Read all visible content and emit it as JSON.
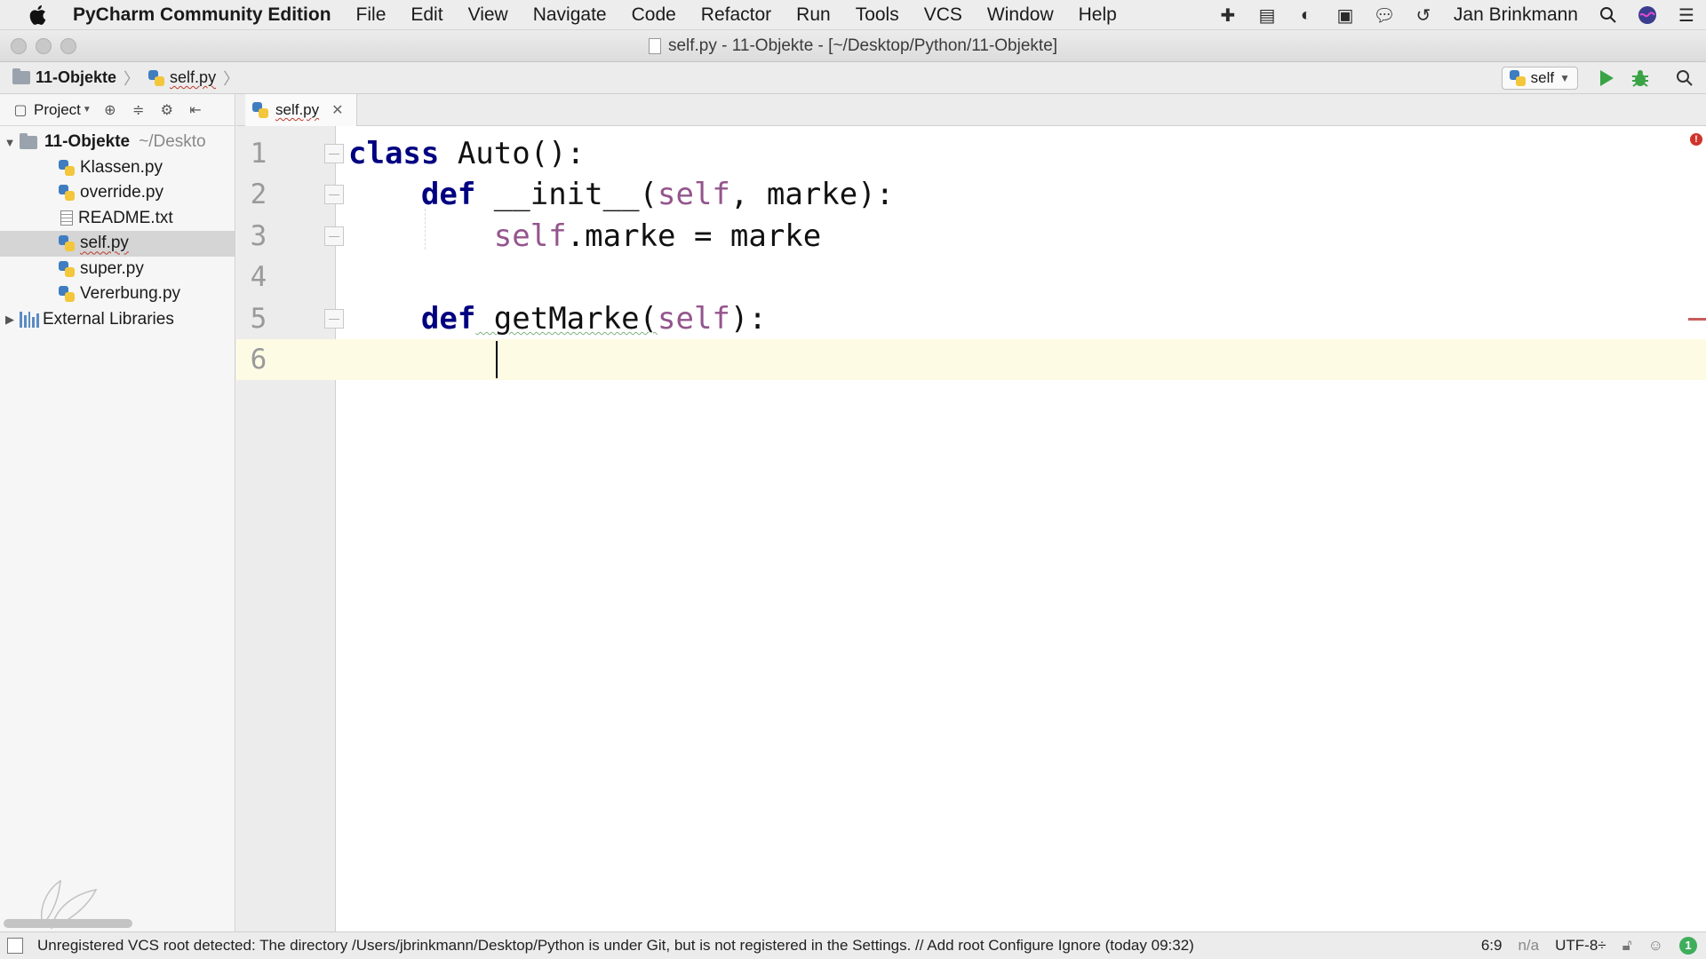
{
  "menubar": {
    "app_name": "PyCharm Community Edition",
    "items": [
      "File",
      "Edit",
      "View",
      "Navigate",
      "Code",
      "Refactor",
      "Run",
      "Tools",
      "VCS",
      "Window",
      "Help"
    ],
    "user": "Jan Brinkmann"
  },
  "window": {
    "title": "self.py - 11-Objekte - [~/Desktop/Python/11-Objekte]"
  },
  "navbar": {
    "project_crumb": "11-Objekte",
    "file_crumb": "self.py",
    "run_config": "self"
  },
  "project_panel": {
    "view_label": "Project",
    "root_name": "11-Objekte",
    "root_path": "~/Deskto",
    "files": [
      {
        "name": "Klassen.py",
        "type": "python"
      },
      {
        "name": "override.py",
        "type": "python"
      },
      {
        "name": "README.txt",
        "type": "text"
      },
      {
        "name": "self.py",
        "type": "python"
      },
      {
        "name": "super.py",
        "type": "python"
      },
      {
        "name": "Vererbung.py",
        "type": "python"
      }
    ],
    "external_libraries": "External Libraries"
  },
  "editor": {
    "tab_label": "self.py",
    "line_numbers": [
      "1",
      "2",
      "3",
      "4",
      "5",
      "6"
    ],
    "code": {
      "l1_kw": "class",
      "l1_rest": " Auto():",
      "l2_kw": "def",
      "l2_name": " __init__(",
      "l2_self": "self",
      "l2_rest": ", marke):",
      "l3_self": "self",
      "l3_rest": ".marke = marke",
      "l5_kw": "def",
      "l5_name": " getMarke(",
      "l5_self": "self",
      "l5_rest": "):"
    },
    "cursor_position": "6:9"
  },
  "statusbar": {
    "message": "Unregistered VCS root detected: The directory /Users/jbrinkmann/Desktop/Python is under Git, but is not registered in the Settings. // Add root  Configure  Ignore (today 09:32)",
    "position": "6:9",
    "line_separator": "n/a",
    "encoding": "UTF-8÷",
    "notifications": "1"
  }
}
